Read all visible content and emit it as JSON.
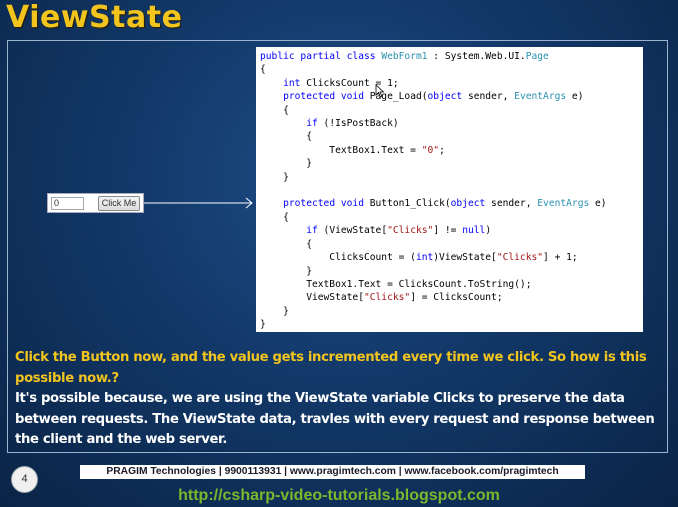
{
  "slide": {
    "title": "ViewState",
    "page_number": "4",
    "question": "Click the Button now, and the value gets incremented every time we click. So how is this possible now.?",
    "answer": "It's possible because, we are using the ViewState variable Clicks to preserve the data between requests. The ViewState data, travles with every request and response between the client and the web server.",
    "footer": "PRAGIM Technologies | 9900113931 | www.pragimtech.com | www.facebook.com/pragimtech",
    "url": "http://csharp-video-tutorials.blogspot.com"
  },
  "demo": {
    "textbox_value": "0",
    "button_label": "Click Me"
  },
  "code": {
    "line1": {
      "a": "public partial class ",
      "b": "WebForm1",
      "c": " : System.Web.UI.",
      "d": "Page"
    },
    "line2": "{",
    "line3": {
      "a": "    ",
      "b": "int",
      "c": " ClicksCount = 1;"
    },
    "line4": {
      "a": "    ",
      "b": "protected void",
      "c": " Page_Load(",
      "d": "object",
      "e": " sender, ",
      "f": "EventArgs",
      "g": " e)"
    },
    "line5": "    {",
    "line6": {
      "a": "        ",
      "b": "if",
      "c": " (!IsPostBack)"
    },
    "line7": "        {",
    "line8": {
      "a": "            TextBox1.Text = ",
      "b": "\"0\"",
      "c": ";"
    },
    "line9": "        }",
    "line10": "    }",
    "line11": "",
    "line12": {
      "a": "    ",
      "b": "protected void",
      "c": " Button1_Click(",
      "d": "object",
      "e": " sender, ",
      "f": "EventArgs",
      "g": " e)"
    },
    "line13": "    {",
    "line14": {
      "a": "        ",
      "b": "if",
      "c": " (ViewState[",
      "d": "\"Clicks\"",
      "e": "] != ",
      "f": "null",
      "g": ")"
    },
    "line15": "        {",
    "line16": {
      "a": "            ClicksCount = (",
      "b": "int",
      "c": ")ViewState[",
      "d": "\"Clicks\"",
      "e": "] + 1;"
    },
    "line17": "        }",
    "line18": "        TextBox1.Text = ClicksCount.ToString();",
    "line19": {
      "a": "        ViewState[",
      "b": "\"Clicks\"",
      "c": "] = ClicksCount;"
    },
    "line20": "    }",
    "line21": "}"
  },
  "colors": {
    "title": "#f2c41e",
    "keyword": "#0000ff",
    "type": "#2b91af",
    "string": "#a31515",
    "url": "#7ab82d"
  }
}
